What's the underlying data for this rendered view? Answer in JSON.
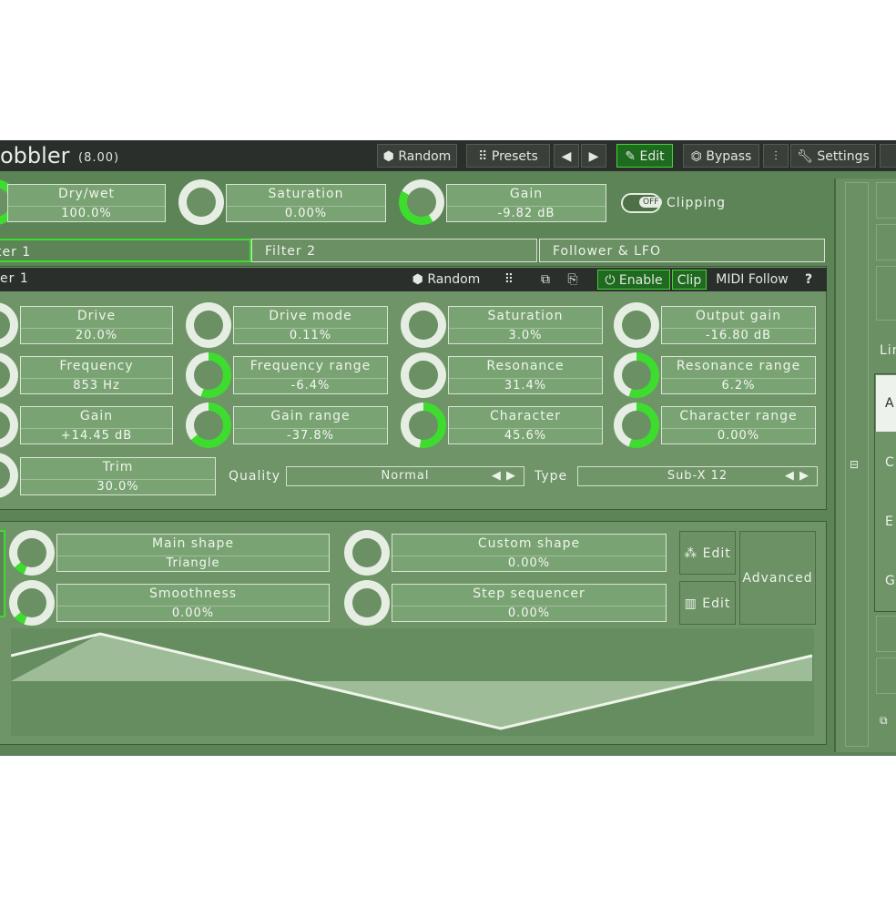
{
  "app": {
    "title": "obbler",
    "version": "(8.00)"
  },
  "toolbar": {
    "random": "Random",
    "presets": "Presets",
    "prev": "◀",
    "next": "▶",
    "edit": "Edit",
    "bypass": "Bypass",
    "settings": "Settings"
  },
  "global": {
    "drywet": {
      "name": "Dry/wet",
      "value": "100.0%"
    },
    "saturation": {
      "name": "Saturation",
      "value": "0.00%"
    },
    "gain": {
      "name": "Gain",
      "value": "-9.82 dB"
    },
    "clipping_toggle": "OFF",
    "clipping_label": "Clipping"
  },
  "tabs": [
    "ter 1",
    "Filter 2",
    "Follower & LFO"
  ],
  "filter": {
    "title": "er 1",
    "random": "Random",
    "enable": "Enable",
    "clip": "Clip",
    "midi_follow": "MIDI Follow",
    "help": "?",
    "params": [
      {
        "name": "Drive",
        "value": "20.0%"
      },
      {
        "name": "Drive mode",
        "value": "0.11%"
      },
      {
        "name": "Saturation",
        "value": "3.0%"
      },
      {
        "name": "Output gain",
        "value": "-16.80 dB"
      },
      {
        "name": "Frequency",
        "value": "853 Hz"
      },
      {
        "name": "Frequency range",
        "value": "-6.4%"
      },
      {
        "name": "Resonance",
        "value": "31.4%"
      },
      {
        "name": "Resonance range",
        "value": "6.2%"
      },
      {
        "name": "Gain",
        "value": "+14.45 dB"
      },
      {
        "name": "Gain range",
        "value": "-37.8%"
      },
      {
        "name": "Character",
        "value": "45.6%"
      },
      {
        "name": "Character range",
        "value": "0.00%"
      }
    ],
    "trim": {
      "name": "Trim",
      "value": "30.0%"
    },
    "quality_label": "Quality",
    "quality_value": "Normal",
    "type_label": "Type",
    "type_value": "Sub-X 12"
  },
  "lfo": {
    "main_shape": {
      "name": "Main shape",
      "value": "Triangle"
    },
    "custom_shape": {
      "name": "Custom shape",
      "value": "0.00%"
    },
    "smoothness": {
      "name": "Smoothness",
      "value": "0.00%"
    },
    "step_sequencer": {
      "name": "Step sequencer",
      "value": "0.00%"
    },
    "edit1": "Edit",
    "edit2": "Edit",
    "advanced": "Advanced"
  },
  "sidebar": {
    "lin": "Lin",
    "a": "A",
    "c": "C",
    "e": "E",
    "g": "G"
  },
  "colors": {
    "accent": "#3ddc2f",
    "panel": "#5c8456",
    "bar": "#2b2f2b"
  }
}
